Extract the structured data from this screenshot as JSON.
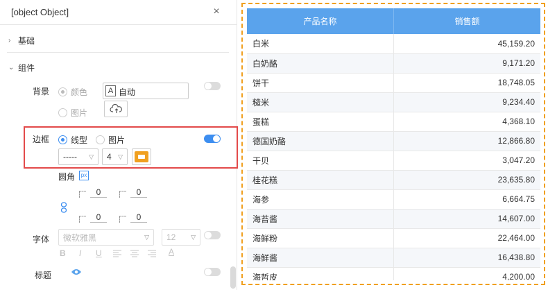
{
  "panel": {
    "title": {
      "label": "标题"
    },
    "close_glyph": "×",
    "sections": {
      "basic": "基础",
      "component": "组件"
    },
    "background": {
      "label": "背景",
      "opt_color": "颜色",
      "opt_image": "图片",
      "color_value": "自动",
      "color_prefix": "A"
    },
    "border": {
      "label": "边框",
      "opt_line": "线型",
      "opt_image": "图片",
      "line_style": "-----",
      "width": "4",
      "color": "#f0a020"
    },
    "radius": {
      "label": "圆角",
      "unit": "px",
      "values": [
        "0",
        "0",
        "0",
        "0"
      ]
    },
    "font": {
      "label": "字体",
      "family": "微软雅黑",
      "size": "12",
      "format_bold": "B",
      "format_italic": "I",
      "format_underline": "U",
      "format_color": "A"
    }
  },
  "table": {
    "columns": [
      "产品名称",
      "销售额"
    ],
    "rows": [
      [
        "白米",
        "45,159.20"
      ],
      [
        "白奶酪",
        "9,171.20"
      ],
      [
        "饼干",
        "18,748.05"
      ],
      [
        "糙米",
        "9,234.40"
      ],
      [
        "蛋糕",
        "4,368.10"
      ],
      [
        "德国奶酪",
        "12,866.80"
      ],
      [
        "干贝",
        "3,047.20"
      ],
      [
        "桂花糕",
        "23,635.80"
      ],
      [
        "海参",
        "6,664.75"
      ],
      [
        "海苔酱",
        "14,607.00"
      ],
      [
        "海鲜粉",
        "22,464.00"
      ],
      [
        "海鲜酱",
        "16,438.80"
      ],
      [
        "海哲皮",
        "4,200.00"
      ]
    ],
    "header_color": "#5aa3ec",
    "border_color": "#f0a020"
  }
}
